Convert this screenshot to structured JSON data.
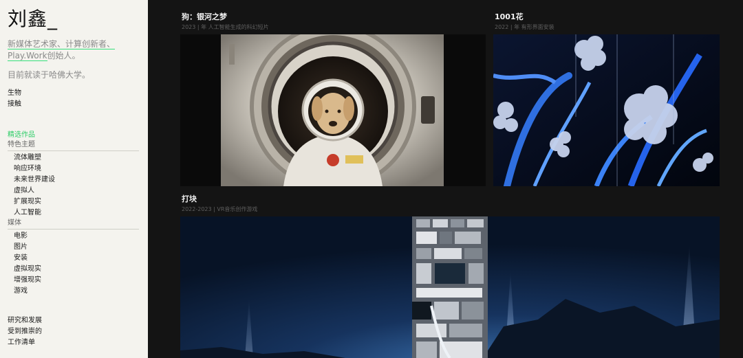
{
  "site": {
    "title": "刘鑫_"
  },
  "bio": {
    "part1": "新媒体艺术家、计算创新者、",
    "part2": "Play.Work",
    "part3": "创始人。"
  },
  "study": "目前就读于哈佛大学。",
  "nav_top": [
    "生物",
    "接触"
  ],
  "featured_label": "精选作品",
  "groups": {
    "themes": {
      "label": "特色主题",
      "items": [
        "流体雕塑",
        "响应环境",
        "未来世界建设",
        "虚拟人",
        "扩展现实",
        "人工智能"
      ]
    },
    "media": {
      "label": "媒体",
      "items": [
        "电影",
        "图片",
        "安装",
        "虚拟现实",
        "增强现实",
        "游戏"
      ]
    }
  },
  "nav_bottom": [
    "研究和发展",
    "受到推崇的",
    "工作清单"
  ],
  "projects": [
    {
      "title": "狗：银河之梦",
      "subtitle": "2023 | 年 人工智能生成的科幻短片"
    },
    {
      "title": "1001花",
      "subtitle": "2022 | 年 有形界面安装"
    },
    {
      "title": "打块",
      "subtitle": "2022-2023 | VR音乐创作游戏"
    }
  ],
  "colors": {
    "sidebar_bg": "#f4f3ee",
    "main_bg": "#141414",
    "accent_green": "#2ccc66"
  }
}
